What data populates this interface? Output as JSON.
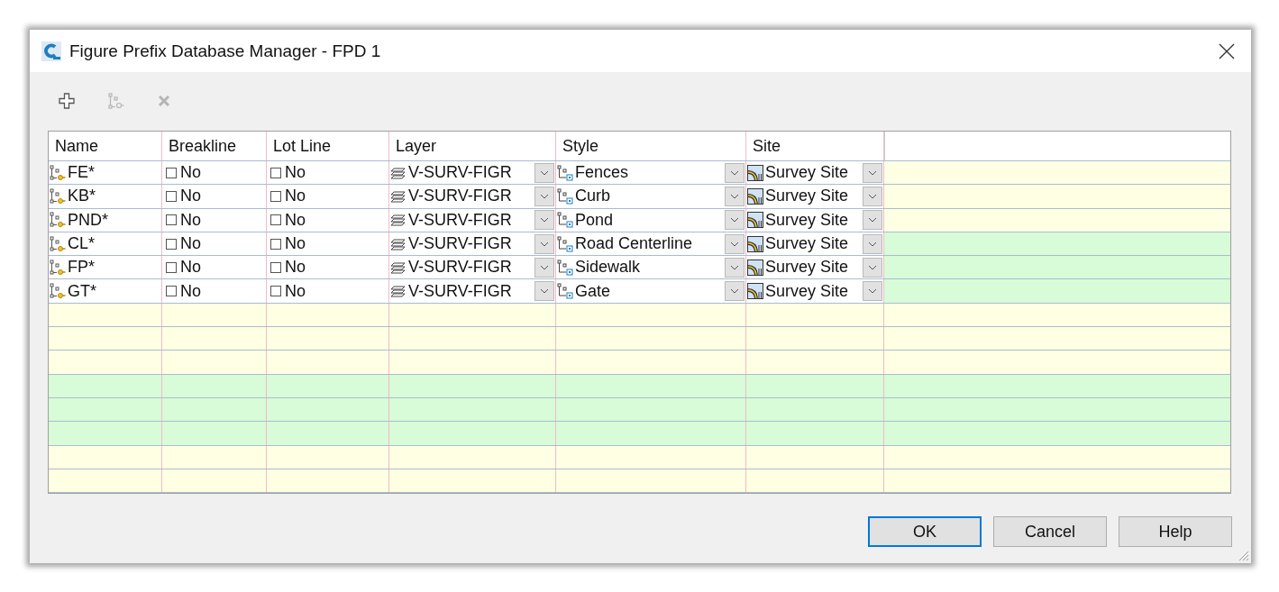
{
  "window": {
    "title": "Figure Prefix Database Manager - FPD 1"
  },
  "toolbar": [
    {
      "kind": "add",
      "disabled": false
    },
    {
      "kind": "copy",
      "disabled": true
    },
    {
      "kind": "delete",
      "disabled": true
    }
  ],
  "table": {
    "columns": [
      "Name",
      "Breakline",
      "Lot Line",
      "Layer",
      "Style",
      "Site"
    ],
    "rows": [
      {
        "name": "FE*",
        "breakline": {
          "checked": false,
          "label": "No"
        },
        "lot_line": {
          "checked": false,
          "label": "No"
        },
        "layer": "V-SURV-FIGR",
        "style": "Fences",
        "site": "Survey Site"
      },
      {
        "name": "KB*",
        "breakline": {
          "checked": false,
          "label": "No"
        },
        "lot_line": {
          "checked": false,
          "label": "No"
        },
        "layer": "V-SURV-FIGR",
        "style": "Curb",
        "site": "Survey Site"
      },
      {
        "name": "PND*",
        "breakline": {
          "checked": false,
          "label": "No"
        },
        "lot_line": {
          "checked": false,
          "label": "No"
        },
        "layer": "V-SURV-FIGR",
        "style": "Pond",
        "site": "Survey Site"
      },
      {
        "name": "CL*",
        "breakline": {
          "checked": false,
          "label": "No"
        },
        "lot_line": {
          "checked": false,
          "label": "No"
        },
        "layer": "V-SURV-FIGR",
        "style": "Road Centerline",
        "site": "Survey Site"
      },
      {
        "name": "FP*",
        "breakline": {
          "checked": false,
          "label": "No"
        },
        "lot_line": {
          "checked": false,
          "label": "No"
        },
        "layer": "V-SURV-FIGR",
        "style": "Sidewalk",
        "site": "Survey Site"
      },
      {
        "name": "GT*",
        "breakline": {
          "checked": false,
          "label": "No"
        },
        "lot_line": {
          "checked": false,
          "label": "No"
        },
        "layer": "V-SURV-FIGR",
        "style": "Gate",
        "site": "Survey Site"
      }
    ]
  },
  "buttons": [
    {
      "label": "OK",
      "focused": true
    },
    {
      "label": "Cancel",
      "focused": false
    },
    {
      "label": "Help",
      "focused": false
    }
  ]
}
